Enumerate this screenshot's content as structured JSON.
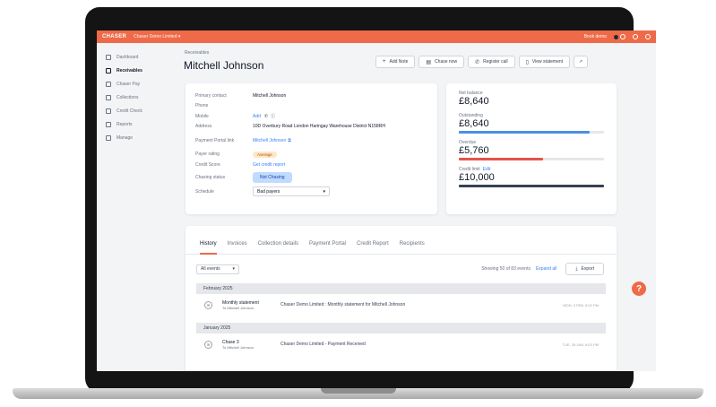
{
  "app": {
    "logo": "CHASER",
    "company": "Chaser Demo Limited ▾"
  },
  "topbar": {
    "right_text": "Book demo"
  },
  "sidebar": {
    "items": [
      {
        "label": "Dashboard",
        "icon": "home-icon"
      },
      {
        "label": "Receivables",
        "icon": "document-icon"
      },
      {
        "label": "Chaser Pay",
        "icon": "card-icon"
      },
      {
        "label": "Collections",
        "icon": "collections-icon"
      },
      {
        "label": "Credit Check",
        "icon": "search-icon"
      },
      {
        "label": "Reports",
        "icon": "reports-icon"
      },
      {
        "label": "Manage",
        "icon": "manage-icon"
      }
    ]
  },
  "header": {
    "breadcrumb": "Receivables",
    "title": "Mitchell Johnson",
    "actions": [
      "Add Note",
      "Chase now",
      "Register call",
      "View statement"
    ]
  },
  "details": {
    "primary_contact_label": "Primary contact",
    "primary_contact": "Mitchell Johnson",
    "phone_label": "Phone",
    "mobile_label": "Mobile",
    "mobile_add": "Add",
    "address_label": "Address",
    "address": "10D Overbury Road London Haringay Warehouse District N158RH",
    "portal_label": "Payment Portal link",
    "portal_link": "Mitchell Johnson",
    "payer_rating_label": "Payer rating",
    "payer_rating": "Average",
    "credit_score_label": "Credit Score",
    "credit_score_link": "Get credit report",
    "chasing_status_label": "Chasing status",
    "chasing_status": "Not Chasing",
    "schedule_label": "Schedule",
    "schedule": "Bad payers"
  },
  "balances": {
    "net_label": "Net balance",
    "net": "£8,640",
    "outstanding_label": "Outstanding",
    "outstanding": "£8,640",
    "outstanding_fraction": 0.9,
    "overdue_label": "Overdue",
    "overdue": "£5,760",
    "overdue_fraction": 0.58,
    "credit_label": "Credit limit",
    "credit_edit": "Edit",
    "credit": "£10,000",
    "credit_fraction": 1.0,
    "colors": {
      "outstanding": "#4a90e2",
      "overdue": "#e5534b",
      "credit": "#374151"
    }
  },
  "history": {
    "tabs": [
      "History",
      "Invoices",
      "Collection details",
      "Payment Portal",
      "Credit Report",
      "Recipients"
    ],
    "filter": "All events",
    "showing": "Showing 50 of 83 events",
    "expand_all": "Expand all",
    "export": "Export",
    "groups": [
      {
        "month": "February 2025",
        "events": [
          {
            "icon": "envelope-icon",
            "title": "Monthly statement",
            "sub": "To Mitchell Johnson",
            "desc": "Chaser Demo Limited : Monthly statement for Mitchell Johnson",
            "time": "MON, 3 FEB, 8:02 PM"
          }
        ]
      },
      {
        "month": "January 2025",
        "events": [
          {
            "icon": "envelope-icon",
            "title": "Chase 3",
            "sub": "To Mitchell Johnson",
            "desc": "Chaser Demo Limited - Payment Received",
            "time": "TUE, 28 JAN, 8:03 PM"
          }
        ]
      }
    ]
  },
  "help": "?"
}
